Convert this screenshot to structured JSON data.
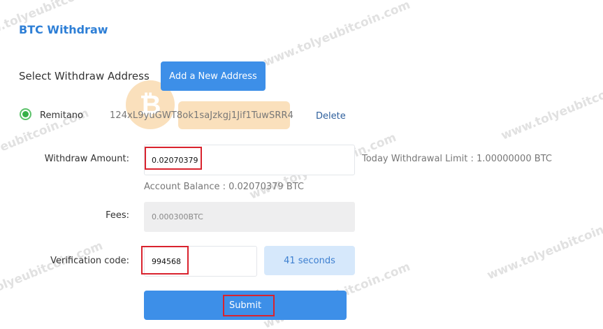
{
  "page": {
    "title": "BTC Withdraw",
    "select_address_label": "Select Withdraw Address",
    "add_address_button": "Add a New Address"
  },
  "address": {
    "name": "Remitano",
    "value": "124xL9yuGWT8ok1saJzkgj1Jif1TuwSRR4",
    "delete_label": "Delete",
    "selected": true
  },
  "form": {
    "amount_label": "Withdraw Amount:",
    "amount_value": "0.02070379",
    "limit_text": "Today Withdrawal Limit : 1.00000000 BTC",
    "balance_text": "Account Balance : 0.02070379 BTC",
    "fees_label": "Fees:",
    "fees_value": "0.000300BTC",
    "code_label": "Verification code:",
    "code_value": "994568",
    "countdown_label": "41 seconds",
    "submit_label": "Submit"
  },
  "watermark": {
    "text": "www.tolyeubitcoin.com"
  },
  "colors": {
    "accent": "#3d8fe8",
    "title": "#2e7fd6",
    "radio": "#36b048",
    "highlight": "#d9232e"
  }
}
